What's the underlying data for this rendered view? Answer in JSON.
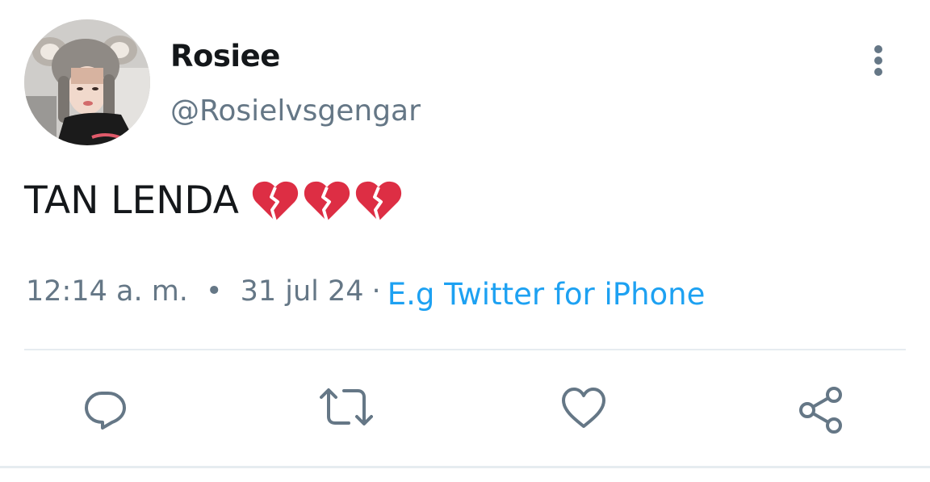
{
  "tweet": {
    "display_name": "Rosiee",
    "handle": "@Rosielvsgengar",
    "text": "TAN LENDA",
    "emojis": [
      "broken-heart-emoji",
      "broken-heart-emoji",
      "broken-heart-emoji"
    ],
    "time": "12:14 a. m.",
    "separator_dot": "•",
    "date": "31 jul 24",
    "source_separator": "·",
    "source": "E.g Twitter for iPhone"
  },
  "icons": {
    "more": "more-vertical-icon",
    "reply": "reply-icon",
    "retweet": "retweet-icon",
    "like": "heart-icon",
    "share": "share-icon"
  },
  "colors": {
    "text_primary": "#14171a",
    "text_secondary": "#657786",
    "link": "#1da1f2",
    "icon": "#657786",
    "divider": "#e6ecf0",
    "broken_heart": "#dd2e44"
  }
}
